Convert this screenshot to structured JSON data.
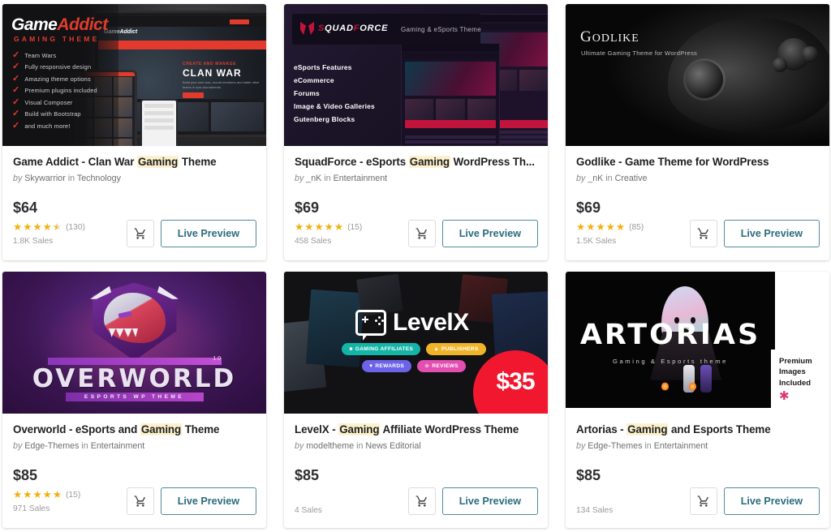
{
  "page": {
    "accent_link": "#2b6c80",
    "highlight_bg": "#fcf1cd",
    "star_color": "#f1b10c",
    "keyword": "Gaming"
  },
  "labels": {
    "by": "by",
    "in": "in",
    "cart_icon": "shopping-cart-icon",
    "preview_label": "Live Preview"
  },
  "items": [
    {
      "title_pre": "Game Addict - Clan War ",
      "title_mark": "Gaming",
      "title_post": " Theme",
      "author": "Skywarrior",
      "category": "Technology",
      "price": "$64",
      "rating": 4.5,
      "rating_count": "(130)",
      "sales": "1.8K Sales",
      "preview_label": "Live Preview",
      "thumb": {
        "logo_white": "Game",
        "logo_red": "Addict",
        "tagline": "GAMING THEME",
        "features": [
          "Team Wars",
          "Fully responsive design",
          "Amazing theme options",
          "Premium plugins included",
          "Visual Composer",
          "Build with Bootstrap",
          "and much more!"
        ],
        "hero_kicker": "CREATE AND MANAGE",
        "hero_title": "CLAN WAR",
        "hero_text": "Build your own clan, recruit members and battle other teams in epic tournaments.",
        "brand_small": "GameAddict"
      }
    },
    {
      "title_pre": "SquadForce - eSports ",
      "title_mark": "Gaming",
      "title_post": " WordPress Th...",
      "author": "_nK",
      "category": "Entertainment",
      "price": "$69",
      "rating": 5,
      "rating_count": "(15)",
      "sales": "458 Sales",
      "preview_label": "Live Preview",
      "thumb": {
        "brand_a": "S",
        "brand_b": "QUAD",
        "brand_c": "F",
        "brand_d": "ORCE",
        "tagline": "Gaming & eSports Theme",
        "features": [
          "eSports Features",
          "eCommerce",
          "Forums",
          "Image & Video Galleries",
          "Gutenberg Blocks"
        ]
      }
    },
    {
      "title_pre": "Godlike - Game Theme for WordPress",
      "title_mark": "",
      "title_post": "",
      "author": "_nK",
      "category": "Creative",
      "price": "$69",
      "rating": 5,
      "rating_count": "(85)",
      "sales": "1.5K Sales",
      "preview_label": "Live Preview",
      "thumb": {
        "title_big": "G",
        "title_rest": "ODLIKE",
        "tagline": "Ultimate Gaming Theme for WordPress"
      }
    },
    {
      "title_pre": "Overworld - eSports and ",
      "title_mark": "Gaming",
      "title_post": " Theme",
      "author": "Edge-Themes",
      "category": "Entertainment",
      "price": "$85",
      "rating": 5,
      "rating_count": "(15)",
      "sales": "971 Sales",
      "preview_label": "Live Preview",
      "thumb": {
        "title": "OVERWORLD",
        "version": "1.0",
        "tagline": "ESPORTS WP THEME"
      }
    },
    {
      "title_pre": "LevelX - ",
      "title_mark": "Gaming",
      "title_post": " Affiliate WordPress Theme",
      "author": "modeltheme",
      "category": "News Editorial",
      "price": "$85",
      "rating": null,
      "rating_count": "",
      "sales": "4 Sales",
      "preview_label": "Live Preview",
      "thumb": {
        "word": "LevelX",
        "price_badge": "$35",
        "pills": [
          {
            "label": "GAMING AFFILIATES",
            "color": "#14b4a6",
            "icon": "■"
          },
          {
            "label": "PUBLISHERS",
            "color": "#f0b429",
            "icon": "▲"
          },
          {
            "label": "REWARDS",
            "color": "#6c63e8",
            "icon": "♥"
          },
          {
            "label": "REVIEWS",
            "color": "#e24fb0",
            "icon": "☆"
          }
        ]
      }
    },
    {
      "title_pre": "Artorias - ",
      "title_mark": "Gaming",
      "title_post": " and Esports Theme",
      "author": "Edge-Themes",
      "category": "Entertainment",
      "price": "$85",
      "rating": null,
      "rating_count": "",
      "sales": "134 Sales",
      "preview_label": "Live Preview",
      "thumb": {
        "title": "ARTORIAS",
        "tagline": "Gaming & Esports theme",
        "badge_line1": "Premium",
        "badge_line2": "Images",
        "badge_line3": "Included",
        "badge_star": "✱"
      }
    }
  ]
}
